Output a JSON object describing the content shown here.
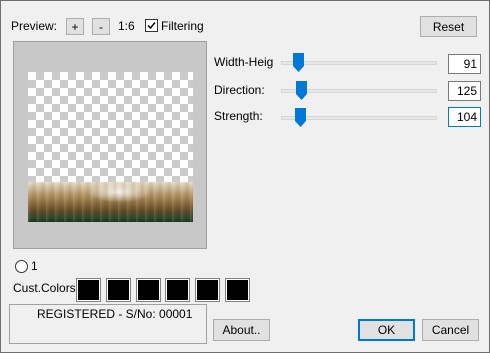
{
  "toolbar": {
    "preview_label": "Preview:",
    "zoom_in_label": "+",
    "zoom_out_label": "-",
    "zoom_ratio": "1:6",
    "filtering_label": "Filtering",
    "filtering_checked": true,
    "reset_label": "Reset"
  },
  "sliders": [
    {
      "name": "width-height",
      "label": "Width-Heig",
      "value": "91",
      "level": 0.04
    },
    {
      "name": "direction",
      "label": "Direction:",
      "value": "125",
      "level": 0.06
    },
    {
      "name": "strength",
      "label": "Strength:",
      "value": "104",
      "level": 0.05
    }
  ],
  "radio": {
    "label": "1",
    "selected": false
  },
  "custom_colors": {
    "label": "Cust.Colors:",
    "swatches": [
      "#000000",
      "#000000",
      "#000000",
      "#000000",
      "#000000",
      "#000000"
    ]
  },
  "status": {
    "text": "REGISTERED - S/No: 00001"
  },
  "buttons": {
    "about_label": "About..",
    "ok_label": "OK",
    "cancel_label": "Cancel"
  },
  "colors": {
    "accent": "#0078d7",
    "dialog_bg": "#f0f0f0"
  }
}
